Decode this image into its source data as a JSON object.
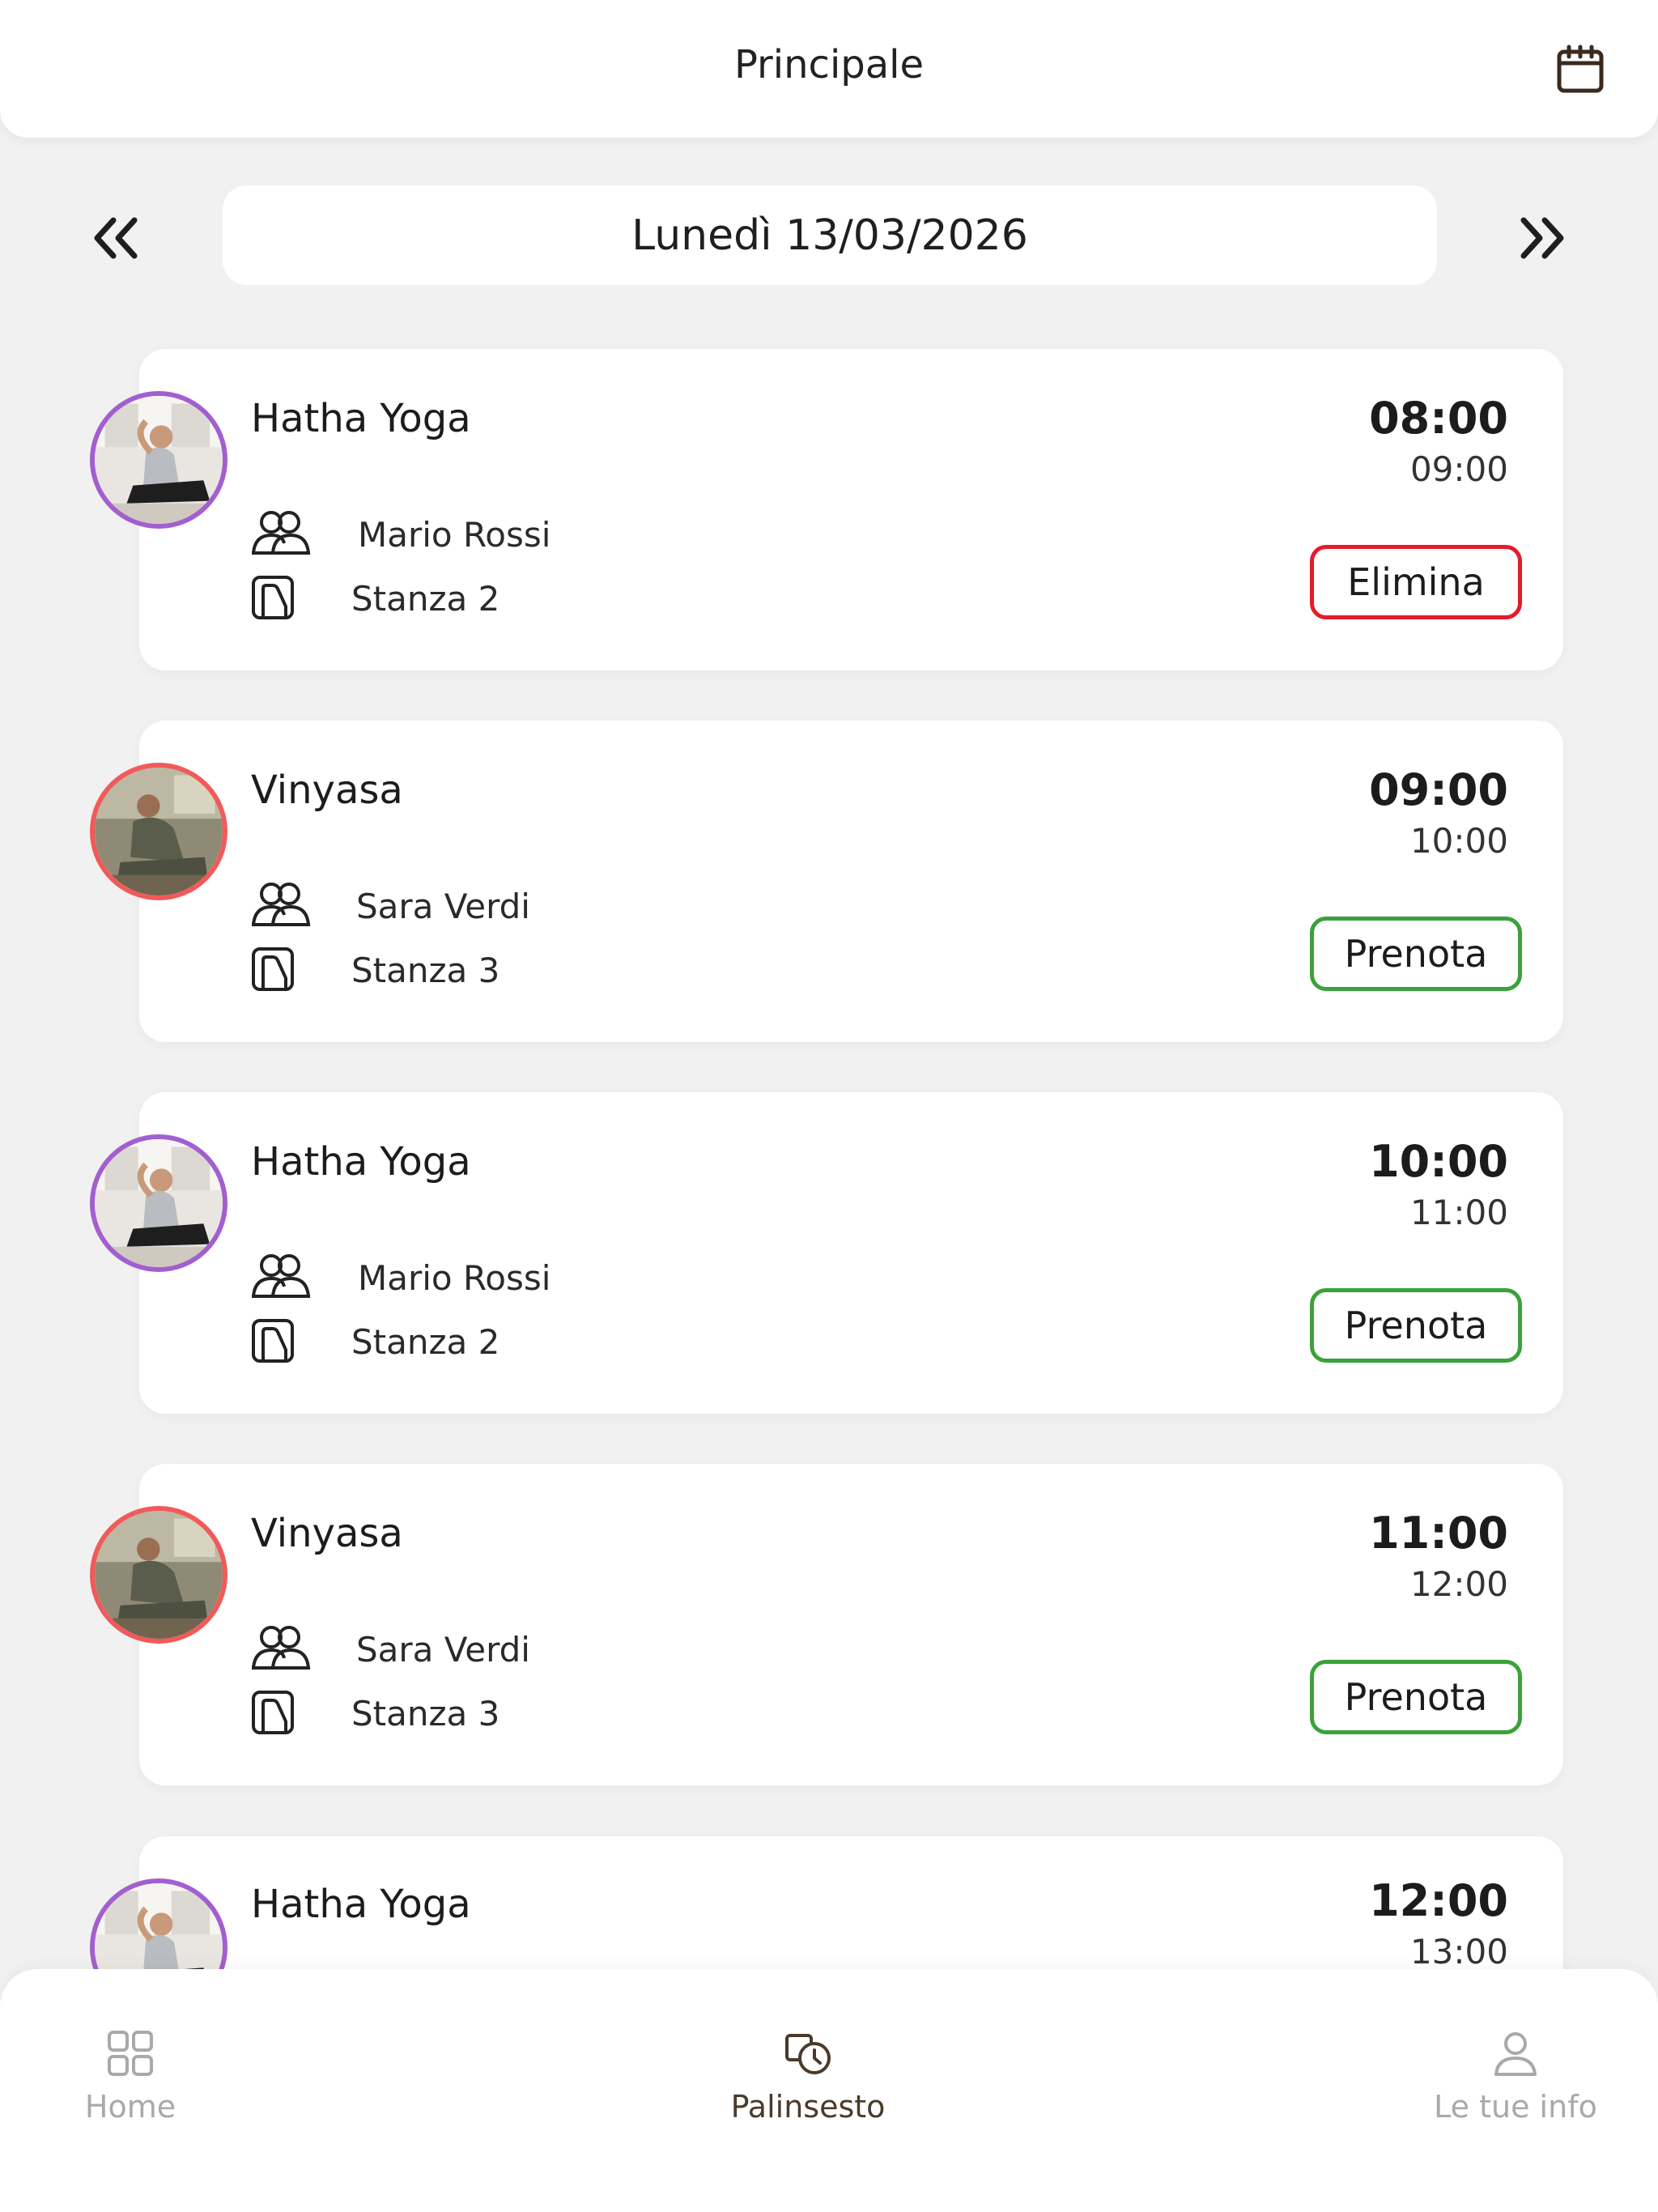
{
  "header": {
    "title": "Principale",
    "calendar_icon": "calendar-icon"
  },
  "date_nav": {
    "prev_icon": "chevrons-left-icon",
    "next_icon": "chevrons-right-icon",
    "date_label": "Lunedì 13/03/2026"
  },
  "classes": [
    {
      "name": "Hatha Yoga",
      "teacher": "Mario Rossi",
      "room": "Stanza 2",
      "start": "08:00",
      "end": "09:00",
      "action": "Elimina",
      "action_type": "delete"
    },
    {
      "name": "Vinyasa",
      "teacher": "Sara Verdi",
      "room": "Stanza 3",
      "start": "09:00",
      "end": "10:00",
      "action": "Prenota",
      "action_type": "book"
    },
    {
      "name": "Hatha Yoga",
      "teacher": "Mario Rossi",
      "room": "Stanza 2",
      "start": "10:00",
      "end": "11:00",
      "action": "Prenota",
      "action_type": "book"
    },
    {
      "name": "Vinyasa",
      "teacher": "Sara Verdi",
      "room": "Stanza 3",
      "start": "11:00",
      "end": "12:00",
      "action": "Prenota",
      "action_type": "book"
    },
    {
      "name": "Hatha Yoga",
      "start": "12:00",
      "end": "13:00"
    }
  ],
  "tabbar": {
    "items": [
      {
        "label": "Home",
        "icon": "grid-icon",
        "active": false
      },
      {
        "label": "Palinsesto",
        "icon": "schedule-icon",
        "active": true
      },
      {
        "label": "Le tue info",
        "icon": "user-icon",
        "active": false
      }
    ]
  },
  "colors": {
    "hatha_ring": "#a25fcf",
    "vinyasa_ring": "#f15a5a",
    "book_border": "#3aa23a",
    "delete_border": "#e51b2b",
    "background": "#f1f1f1"
  }
}
